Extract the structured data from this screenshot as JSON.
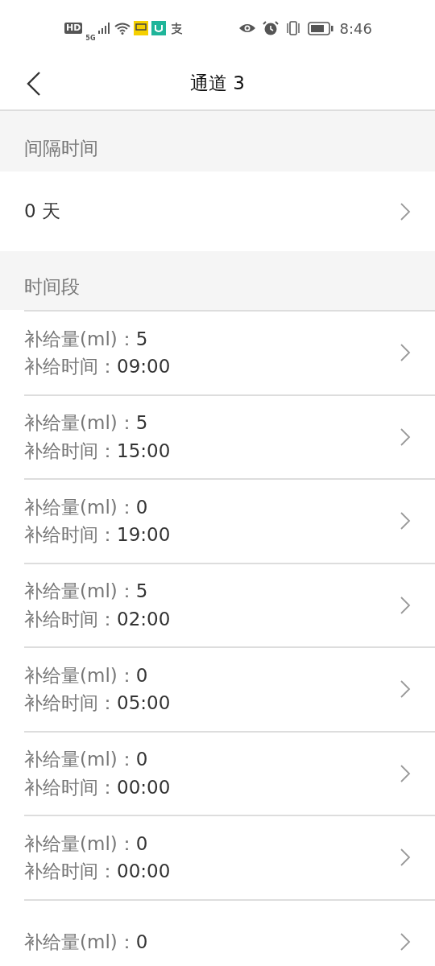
{
  "status_bar": {
    "time": "8:46",
    "hd": "HD",
    "network": "5G"
  },
  "header": {
    "title": "通道 3"
  },
  "interval": {
    "heading": "间隔时间",
    "value": "0 天"
  },
  "periods": {
    "heading": "时间段",
    "rows": [
      {
        "amount_label": "补给量(ml)：",
        "amount": "5",
        "time_label": "补给时间：",
        "time": "09:00"
      },
      {
        "amount_label": "补给量(ml)：",
        "amount": "5",
        "time_label": "补给时间：",
        "time": "15:00"
      },
      {
        "amount_label": "补给量(ml)：",
        "amount": "0",
        "time_label": "补给时间：",
        "time": "19:00"
      },
      {
        "amount_label": "补给量(ml)：",
        "amount": "5",
        "time_label": "补给时间：",
        "time": "02:00"
      },
      {
        "amount_label": "补给量(ml)：",
        "amount": "0",
        "time_label": "补给时间：",
        "time": "05:00"
      },
      {
        "amount_label": "补给量(ml)：",
        "amount": "0",
        "time_label": "补给时间：",
        "time": "00:00"
      },
      {
        "amount_label": "补给量(ml)：",
        "amount": "0",
        "time_label": "补给时间：",
        "time": "00:00"
      },
      {
        "amount_label": "补给量(ml)：",
        "amount": "0"
      }
    ]
  }
}
